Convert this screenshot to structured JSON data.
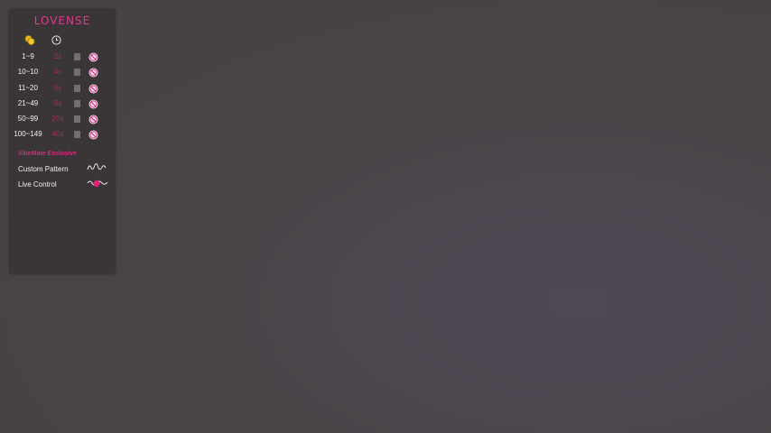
{
  "panel": {
    "logo": "LOVENSE",
    "header": {
      "coin_icon": "coins-icon",
      "time_icon": "clock-icon"
    },
    "levels": [
      {
        "range": "1~9",
        "duration": "2s"
      },
      {
        "range": "10~10",
        "duration": "4s"
      },
      {
        "range": "11~20",
        "duration": "5s"
      },
      {
        "range": "21~49",
        "duration": "8s"
      },
      {
        "range": "50~99",
        "duration": "20s"
      },
      {
        "range": "100~149",
        "duration": "40s"
      }
    ],
    "exclusive": {
      "title": "VibeMate Exclusive",
      "features": [
        {
          "label": "Custom Pattern",
          "icon": "wave-pattern-icon"
        },
        {
          "label": "Live Control",
          "icon": "live-control-icon"
        }
      ]
    }
  },
  "colors": {
    "accent": "#e0237f",
    "panel_bg": "#3a3537",
    "background": "#4a4448"
  }
}
